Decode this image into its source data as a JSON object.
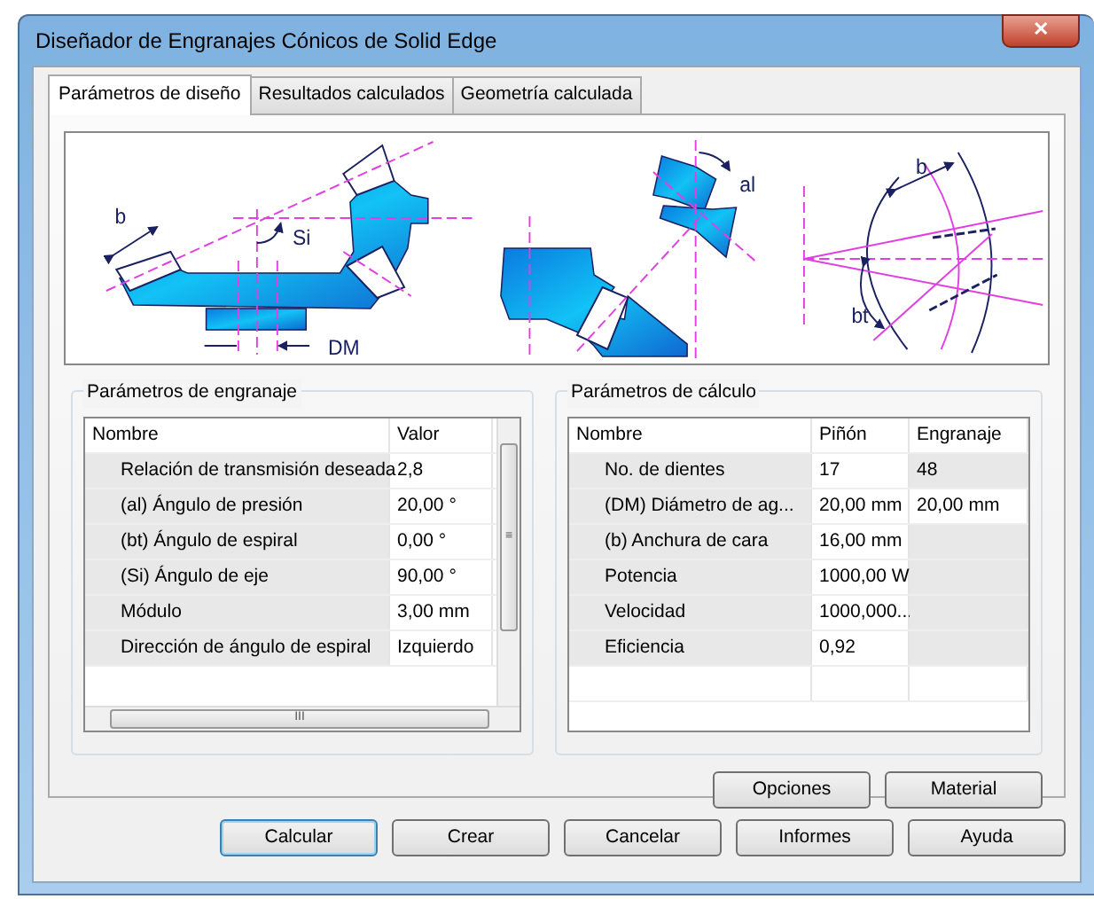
{
  "window": {
    "title": "Diseñador de Engranajes Cónicos de Solid Edge",
    "close": "✕"
  },
  "tabs": [
    {
      "label": "Parámetros de diseño",
      "selected": true
    },
    {
      "label": "Resultados calculados",
      "selected": false
    },
    {
      "label": "Geometría calculada",
      "selected": false
    }
  ],
  "diagram": {
    "labels": [
      {
        "kind": "b",
        "text": "b"
      },
      {
        "kind": "si",
        "text": "Si"
      },
      {
        "kind": "dm",
        "text": "DM"
      },
      {
        "kind": "al",
        "text": "al"
      },
      {
        "kind": "b2",
        "text": "b"
      },
      {
        "kind": "bt",
        "text": "bt"
      }
    ]
  },
  "gear_parameters": {
    "title": "Parámetros de engranaje",
    "columns": [
      "Nombre",
      "Valor"
    ],
    "rows": [
      {
        "name": "Relación de transmisión deseada",
        "value": "2,8"
      },
      {
        "name": "(al) Ángulo de presión",
        "value": "20,00 °"
      },
      {
        "name": "(bt) Ángulo de espiral",
        "value": "0,00 °"
      },
      {
        "name": "(Si) Ángulo de eje",
        "value": "90,00 °"
      },
      {
        "name": "Módulo",
        "value": "3,00 mm"
      },
      {
        "name": "Dirección de ángulo de espiral",
        "value": "Izquierdo"
      }
    ],
    "scroll_thumb": "≡",
    "hscroll_thumb": "III"
  },
  "calc_parameters": {
    "title": "Parámetros de cálculo",
    "columns": [
      "Nombre",
      "Piñón",
      "Engranaje"
    ],
    "rows": [
      {
        "name": "No. de dientes",
        "pinion": "17",
        "gear": {
          "text": "48",
          "editable": false
        }
      },
      {
        "name": "(DM) Diámetro de ag...",
        "pinion": "20,00 mm",
        "gear": {
          "text": "20,00 mm",
          "editable": true
        }
      },
      {
        "name": "(b) Anchura de cara",
        "pinion": "16,00 mm",
        "gear": {
          "editable": false
        }
      },
      {
        "name": "Potencia",
        "pinion": "1000,00 W",
        "gear": {
          "editable": false
        }
      },
      {
        "name": "Velocidad",
        "pinion": "1000,000...",
        "gear": {
          "editable": false
        }
      },
      {
        "name": "Eficiencia",
        "pinion": "0,92",
        "gear": {
          "editable": false
        }
      }
    ]
  },
  "panel_buttons": [
    {
      "label": "Opciones"
    },
    {
      "label": "Material"
    }
  ],
  "dialog_buttons": [
    {
      "label": "Calcular",
      "default": true
    },
    {
      "label": "Crear",
      "default": false
    },
    {
      "label": "Cancelar",
      "default": false
    },
    {
      "label": "Informes",
      "default": false
    },
    {
      "label": "Ayuda",
      "default": false
    }
  ]
}
